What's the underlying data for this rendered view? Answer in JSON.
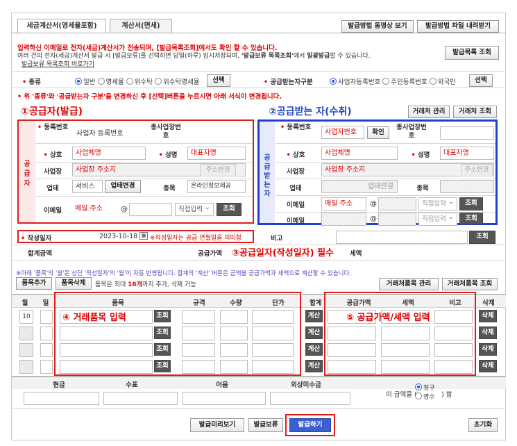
{
  "tabs": [
    "세금계산서(영세율포함)",
    "계산서(면세)"
  ],
  "top_buttons": [
    "발급방법 동영상 보기",
    "발급방법 파일 내려받기"
  ],
  "notice": {
    "line1": "입력하신 이메일로 전자(세금)계산서가 전송되며, [발급목록조회]에서도 확인 할 수 있습니다.",
    "line2a": "여러 건의 전자(세금)계산서 발급 시 [발급보류]를 선택하면 당일(하루) 임시저장되며, ",
    "line2b": "'발급보류 목록조회'",
    "line2c": "에서 ",
    "line2d": "일괄발급",
    "line2e": "할 수 있습니다.",
    "link": "발급보류 목록조회 바로가기",
    "list_button": "발급목록 조회"
  },
  "type_row": {
    "label": "종류",
    "options": [
      "일반",
      "영세율",
      "위수탁",
      "위수탁영세율"
    ],
    "select": "선택",
    "recv_label": "공급받는자구분",
    "recv_options": [
      "사업자등록번호",
      "주민등록번호",
      "외국인"
    ],
    "recv_select": "선택"
  },
  "warning": "• 위 '종류'와 '공급받는자 구분'을 변경하신 후 [선택]버튼을 누르시면 아래 서식이 변경됩니다.",
  "supplier": {
    "heading": "①공급자(발급)",
    "side": "공급자",
    "reg_label": "등록번호",
    "reg_value": "사업자 등록번호",
    "sub_label": "종사업장번호",
    "name_label": "상호",
    "name_value": "사업체명",
    "rep_label": "성명",
    "rep_value": "대표자명",
    "addr_label": "사업장",
    "addr_value": "사업장 주소지",
    "addr_btn": "주소변경",
    "biz_label": "업태",
    "biz_value": "서비스",
    "biz_btn": "업태변경",
    "item_label": "종목",
    "item_value": "온라인정보제공",
    "email_label": "이메일",
    "email_value": "메일 주소",
    "at": "@",
    "direct": "직접입력",
    "query": "조회"
  },
  "receiver": {
    "heading": "②공급받는 자(수취)",
    "side": "공급받는자",
    "buttons": [
      "거래처 관리",
      "거래처 조회"
    ],
    "reg_label": "등록번호",
    "reg_value": "사업자번호",
    "confirm": "확인",
    "sub_label": "종사업장번호",
    "name_label": "상호",
    "name_value": "사업체명",
    "rep_label": "성명",
    "rep_value": "대표자명",
    "addr_label": "사업장",
    "addr_value": "사업장 주소지",
    "addr_btn": "주소변경",
    "biz_label": "업태",
    "biz_btn": "업태변경",
    "item_label": "종목",
    "email_label": "이메일",
    "email_value": "메일 주소",
    "at": "@",
    "direct": "직접입력",
    "query": "조회"
  },
  "date_row": {
    "label": "작성일자",
    "value": "2023-10-18",
    "note": "※작성일자는 공급 연월일을 의미함",
    "memo_label": "비고",
    "query": "조회"
  },
  "totals": {
    "total_label": "합계금액",
    "supply_label": "공급가액",
    "tax_label": "세액",
    "annot": "③공급일자(작성일자) 필수"
  },
  "items_notice": "※아래 '품목'의 '월'은 상단 '작성일자'의 '월'이 자동 반영됩니다. 합계의 '계산' 버튼은 금액을 공급가액과 세액으로 계산할 수 있습니다.",
  "items_bar": {
    "add": "품목추가",
    "del": "품목삭제",
    "desc_a": "품목은 최대 ",
    "desc_b": "16개",
    "desc_c": "까지 추가, 삭제 가능",
    "manage": "거래처품목 관리",
    "lookup": "거래처품목 조회"
  },
  "table": {
    "headers": [
      "월",
      "일",
      "품목",
      "규격",
      "수량",
      "단가",
      "합계",
      "공급가액",
      "세액",
      "비고",
      "삭제"
    ],
    "month": "10",
    "query": "조회",
    "calc": "계산",
    "delete": "삭제",
    "annot_items": "④ 거래품목 입력",
    "annot_amount": "⑤ 공급가액/세액 입력"
  },
  "payment": {
    "headers": [
      "현금",
      "수표",
      "어음",
      "외상미수금"
    ],
    "amount_a": "이 금액을 (",
    "claim": "청구",
    "receipt": "영수",
    "amount_b": ") 함"
  },
  "bottom": {
    "preview": "발급미리보기",
    "hold": "발급보류",
    "issue": "발급하기",
    "reset": "초기화"
  }
}
